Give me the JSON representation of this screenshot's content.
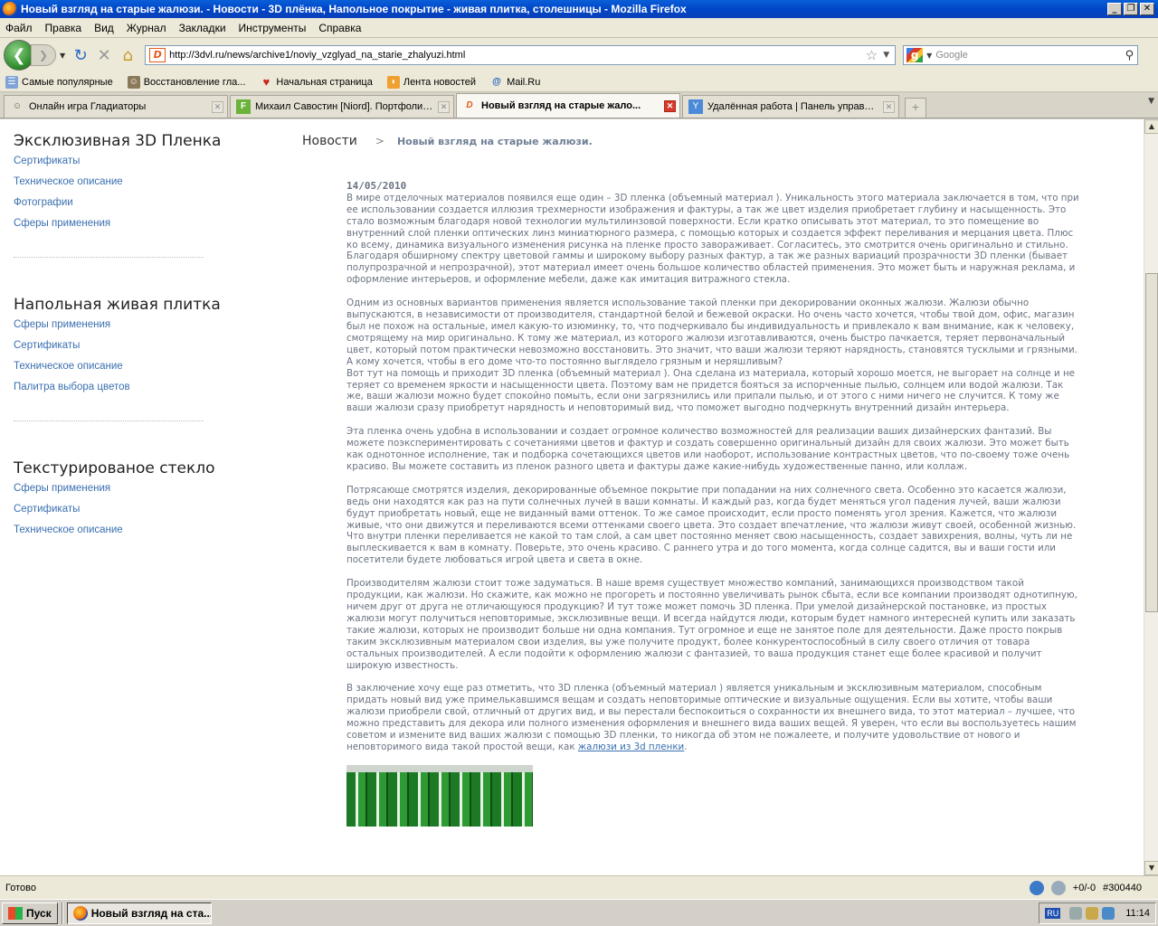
{
  "window": {
    "title": "Новый взгляд на старые жалюзи. - Новости - 3D плёнка, Напольное покрытие - живая плитка, столешницы - Mozilla Firefox"
  },
  "menu": [
    "Файл",
    "Правка",
    "Вид",
    "Журнал",
    "Закладки",
    "Инструменты",
    "Справка"
  ],
  "navbar": {
    "url": "http://3dvl.ru/news/archive1/noviy_vzglyad_na_starie_zhalyuzi.html",
    "search_placeholder": "Google"
  },
  "bookmarks": [
    {
      "label": "Самые популярные",
      "icon": "popular-icon"
    },
    {
      "label": "Восстановление гла...",
      "icon": "bookmark-icon"
    },
    {
      "label": "Начальная страница",
      "icon": "home-page-icon"
    },
    {
      "label": "Лента новостей",
      "icon": "rss-icon"
    },
    {
      "label": "Mail.Ru",
      "icon": "mail-icon"
    }
  ],
  "tabs": [
    {
      "label": "Онлайн игра Гладиаторы",
      "active": false
    },
    {
      "label": "Михаил Савостин [Niord]. Портфолио...",
      "active": false
    },
    {
      "label": "Новый взгляд на старые жало...",
      "active": true
    },
    {
      "label": "Удалённая работа | Панель управле...",
      "active": false
    }
  ],
  "sidebar": {
    "sections": [
      {
        "title": "Эксклюзивная 3D Пленка",
        "links": [
          "Сертификаты",
          "Техническое описание",
          "Фотографии",
          "Сферы применения"
        ]
      },
      {
        "title": "Напольная живая плитка",
        "links": [
          "Сферы применения",
          "Сертификаты",
          "Техническое описание",
          "Палитра выбора цветов"
        ]
      },
      {
        "title": "Текстурированое стекло",
        "links": [
          "Сферы применения",
          "Сертификаты",
          "Техническое описание"
        ]
      }
    ]
  },
  "breadcrumb": {
    "root": "Новости",
    "separator": ">",
    "current": "Новый взгляд на старые жалюзи."
  },
  "article": {
    "date": "14/05/2010",
    "paragraphs": [
      "В мире отделочных материалов появился еще один – 3D пленка (объемный материал ). Уникальность этого материала заключается в том, что при ее использовании создается иллюзия трехмерности изображения и фактуры, а так же цвет изделия приобретает глубину и насыщенность. Это стало возможным благодаря новой технологии мультилинзовой поверхности. Если кратко описывать этот материал, то это помещение во внутренний слой пленки оптических линз миниатюрного размера, с помощью которых и создается эффект переливания и мерцания цвета. Плюс ко всему, динамика визуального изменения рисунка на пленке просто завораживает. Согласитесь, это смотрится очень оригинально и стильно. Благодаря обширному спектру цветовой гаммы и широкому выбору разных фактур, а так же разных вариаций прозрачности 3D пленки (бывает полупрозрачной и непрозрачной), этот материал имеет очень большое количество областей применения. Это может быть и наружная реклама, и оформление интерьеров, и оформление мебели, даже как имитация витражного стекла.",
      "Одним из основных вариантов применения является использование такой пленки при декорировании оконных жалюзи. Жалюзи обычно выпускаются, в независимости от производителя, стандартной белой и бежевой окраски. Но очень часто хочется, чтобы твой дом, офис, магазин был не похож на остальные, имел какую-то изюминку, то, что подчеркивало бы индивидуальность и привлекало к вам внимание, как к человеку, смотрящему на мир оригинально. К тому же материал, из которого жалюзи изготавливаются, очень быстро пачкается, теряет первоначальный цвет, который потом практически невозможно восстановить. Это значит,  что ваши жалюзи теряют нарядность, становятся тусклыми и грязными. А кому хочется, чтобы в его доме что-то постоянно выглядело грязным и неряшливым?\nВот тут на помощь и приходит 3D пленка  (объемный материал ). Она сделана из материала, который хорошо моется, не выгорает на солнце и не теряет со временем яркости и насыщенности цвета. Поэтому вам не придется бояться за испорченные пылью, солнцем или водой жалюзи. Так же, ваши жалюзи можно будет спокойно помыть, если они загрязнились или припали пылью, и от этого с ними ничего не случится. К тому же ваши жалюзи сразу приобретут нарядность и неповторимый вид, что поможет выгодно подчеркнуть внутренний дизайн интерьера.",
      "Эта пленка очень удобна в использовании и создает огромное количество возможностей для реализации ваших дизайнерских фантазий. Вы можете поэкспериментировать с сочетаниями цветов и фактур и создать совершенно оригинальный дизайн для своих жалюзи. Это может быть как однотонное исполнение, так и подборка сочетающихся цветов или наоборот, использование контрастных цветов, что по-своему тоже очень красиво. Вы можете составить из пленок разного цвета и фактуры даже какие-нибудь художественные панно, или коллаж.",
      "Потрясающе смотрятся изделия, декорированные объемное покрытие при попадании на них солнечного света. Особенно это касается жалюзи, ведь они находятся как раз на пути солнечных лучей в ваши комнаты. И каждый раз, когда будет меняться угол падения лучей, ваши жалюзи будут приобретать новый, еще не виданный вами оттенок. То же самое происходит, если просто поменять угол зрения. Кажется, что жалюзи живые, что они движутся и переливаются всеми оттенками своего цвета. Это создает впечатление, что жалюзи живут своей, особенной жизнью. Что внутри пленки переливается не какой то там слой, а сам цвет постоянно меняет свою насыщенность, создает завихрения, волны, чуть ли не выплескивается к вам в комнату. Поверьте, это очень красиво. С раннего утра и до того момента, когда солнце садится, вы и ваши гости или посетители будете любоваться игрой цвета и света в окне.",
      "Производителям жалюзи стоит тоже задуматься. В наше время существует множество компаний, занимающихся производством такой продукции, как жалюзи. Но скажите, как можно не прогореть и постоянно увеличивать рынок сбыта, если все компании производят однотипную, ничем друг от друга не отличающуюся продукцию? И тут тоже может помочь 3D пленка. При умелой дизайнерской постановке, из простых жалюзи могут получиться неповторимые, эксклюзивные вещи. И всегда найдутся люди, которым будет намного интересней купить или заказать такие жалюзи, которых не производит больше ни одна компания. Тут огромное и еще не занятое поле для деятельности. Даже просто покрыв таким эксклюзивным материалом свои изделия, вы уже получите продукт, более конкурентоспособный в силу своего отличия от товара остальных производителей. А если подойти к оформлению жалюзи с фантазией, то ваша продукция станет еще более красивой и получит широкую известность."
    ],
    "last_paragraph": "В заключение хочу еще раз отметить, что 3D пленка (объемный материал )  является уникальным и эксклюзивным материалом, способным придать новый вид уже примелькавшимся вещам и создать неповторимые оптические и визуальные ощущения. Если вы хотите, чтобы ваши жалюзи приобрели свой, отличный от других вид, и вы перестали беспокоиться о сохранности их внешнего вида, то этот материал – лучшее, что можно представить для декора или полного изменения оформления и внешнего вида ваших вещей. Я уверен, что если вы воспользуетесь нашим советом и измените вид ваших жалюзи с помощью 3D пленки, то никогда об этом не пожалеете, и получите удовольствие от нового и неповторимого вида такой простой вещи, как ",
    "link_text": "жалюзи из 3d пленки",
    "link_tail": "."
  },
  "status": {
    "text": "Готово",
    "counter": "+0/-0",
    "id": "#300440"
  },
  "taskbar": {
    "start": "Пуск",
    "window": "Новый взгляд на ста...",
    "lang": "RU",
    "clock": "11:14"
  }
}
